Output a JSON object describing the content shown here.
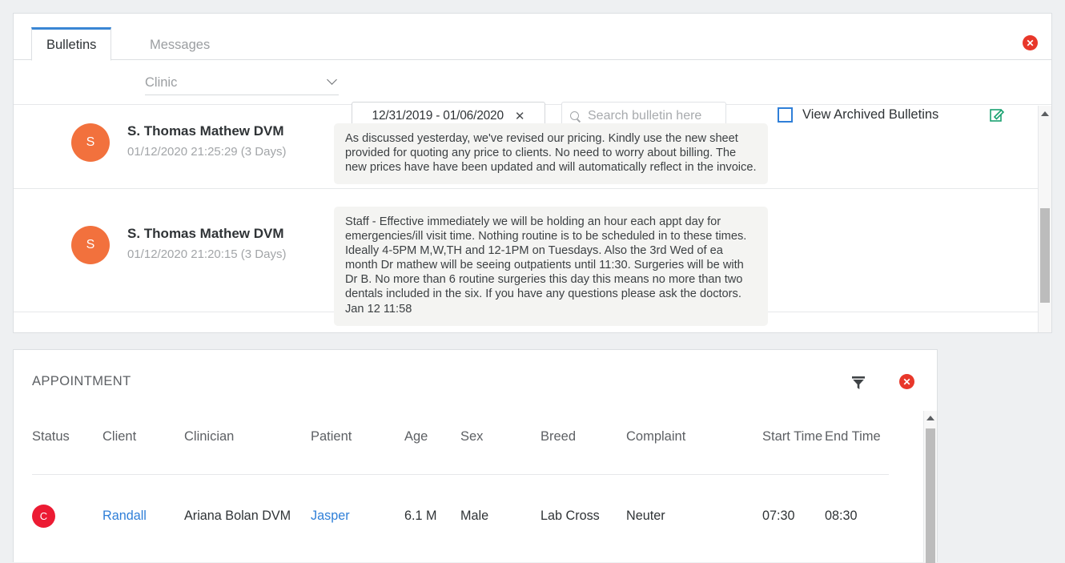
{
  "bulletins_panel": {
    "tabs": [
      {
        "label": "Bulletins",
        "active": true
      },
      {
        "label": "Messages",
        "active": false
      }
    ],
    "close_label": "✕",
    "toolbar": {
      "clinic_select_value": "Clinic",
      "date_range_value": "12/31/2019 - 01/06/2020",
      "date_range_clear": "✕",
      "search_placeholder": "Search bulletin here",
      "archived_label": "View Archived Bulletins",
      "archived_checked": false
    },
    "items": [
      {
        "avatar_initial": "S",
        "author": "S. Thomas Mathew DVM",
        "timestamp": "01/12/2020 21:25:29 (3 Days)",
        "message": "As discussed yesterday, we've revised our pricing. Kindly use the new sheet provided for quoting any price to clients. No need to worry about billing. The new prices have have been updated and will automatically reflect in the invoice.",
        "stamp": ""
      },
      {
        "avatar_initial": "S",
        "author": "S. Thomas Mathew DVM",
        "timestamp": "01/12/2020 21:20:15 (3 Days)",
        "message": "Staff - Effective immediately we will be holding an hour each appt day for emergencies/ill visit time. Nothing routine is to be scheduled in to these times. Ideally 4-5PM M,W,TH and 12-1PM on Tuesdays. Also the 3rd Wed of ea month Dr mathew will be seeing outpatients until 11:30. Surgeries will be with Dr B. No more than 6 routine surgeries this day this means no more than two dentals included in the six. If you have any questions please ask the doctors.",
        "stamp": "Jan 12 11:58"
      }
    ]
  },
  "appointment_panel": {
    "title": "APPOINTMENT",
    "close_label": "✕",
    "columns": [
      "Status",
      "Client",
      "Clinician",
      "Patient",
      "Age",
      "Sex",
      "Breed",
      "Complaint",
      "Start Time",
      "End Time"
    ],
    "rows": [
      {
        "status_initial": "C",
        "client": "Randall",
        "clinician": "Ariana Bolan DVM",
        "patient": "Jasper",
        "age": "6.1 M",
        "sex": "Male",
        "breed": "Lab Cross",
        "complaint": "Neuter",
        "start_time": "07:30",
        "end_time": "08:30"
      }
    ]
  },
  "colors": {
    "accent_blue": "#2f7fd8",
    "tab_active_border": "#3a86d4",
    "avatar_orange": "#f2713d",
    "status_red": "#ec1b33",
    "close_red": "#e8372a",
    "edit_green": "#1aa271"
  }
}
